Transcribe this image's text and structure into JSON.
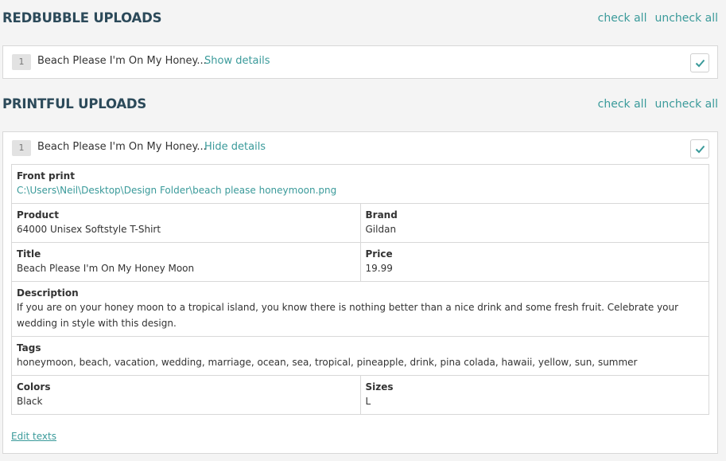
{
  "redbubble": {
    "title": "REDBUBBLE UPLOADS",
    "check_all": "check all",
    "uncheck_all": "uncheck all",
    "items": [
      {
        "number": "1",
        "title": "Beach Please I'm On My Honey...",
        "toggle": "Show details",
        "checked": true
      }
    ]
  },
  "printful": {
    "title": "PRINTFUL UPLOADS",
    "check_all": "check all",
    "uncheck_all": "uncheck all",
    "items": [
      {
        "number": "1",
        "title": "Beach Please I'm On My Honey...",
        "toggle": "Hide details",
        "checked": true,
        "details": {
          "front_print_label": "Front print",
          "front_print_value": "C:\\Users\\Neil\\Desktop\\Design Folder\\beach please honeymoon.png",
          "product_label": "Product",
          "product_value": "64000 Unisex Softstyle T-Shirt",
          "brand_label": "Brand",
          "brand_value": "Gildan",
          "title_label": "Title",
          "title_value": "Beach Please I'm On My Honey Moon",
          "price_label": "Price",
          "price_value": "19.99",
          "description_label": "Description",
          "description_value": "If you are on your honey moon to a tropical island, you know there is nothing better than a nice drink and some fresh fruit. Celebrate your wedding in style with this design.",
          "tags_label": "Tags",
          "tags_value": "honeymoon, beach, vacation, wedding, marriage, ocean, sea, tropical, pineapple, drink, pina colada, hawaii, yellow, sun, summer",
          "colors_label": "Colors",
          "colors_value": "Black",
          "sizes_label": "Sizes",
          "sizes_value": "L"
        },
        "edit_link": "Edit texts"
      }
    ]
  },
  "colors": {
    "accent": "#3a9a9a",
    "heading": "#2c4a5a",
    "background": "#f4f4f4"
  },
  "icons": {
    "checkbox": "check-icon"
  }
}
